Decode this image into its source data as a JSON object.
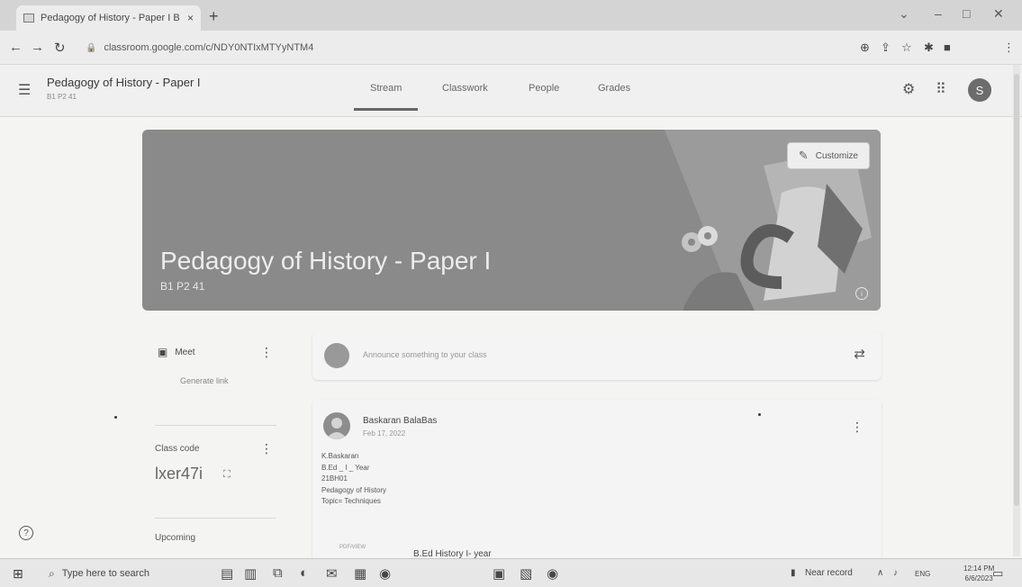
{
  "browser": {
    "tab_title": "Pedagogy of History - Paper I B",
    "tab_close": "×",
    "new_tab": "+",
    "url": "classroom.google.com/c/NDY0NTIxMTYyNTM4",
    "profile_initial": "S"
  },
  "header": {
    "class_name": "Pedagogy of History - Paper I",
    "class_section": "B1 P2 41",
    "tabs": [
      {
        "label": "Stream",
        "active": true
      },
      {
        "label": "Classwork",
        "active": false
      },
      {
        "label": "People",
        "active": false
      },
      {
        "label": "Grades",
        "active": false
      }
    ],
    "avatar_initial": "S"
  },
  "banner": {
    "title": "Pedagogy of History - Paper I",
    "subtitle": "B1 P2 41",
    "customize_label": "Customize"
  },
  "sidebar": {
    "meet_label": "Meet",
    "generate_link": "Generate link",
    "class_code_label": "Class code",
    "class_code": "lxer47i",
    "upcoming_label": "Upcoming"
  },
  "stream": {
    "announce_placeholder": "Announce something to your class",
    "post": {
      "author": "Baskaran BalaBas",
      "date": "Feb 17, 2022",
      "lines": [
        "K.Baskaran",
        "B.Ed _ I _ Year",
        "21BH01",
        "Pedagogy of History",
        "Topic= Techniques"
      ],
      "attachment_thumb": "PDF/VIEW",
      "attachment_title": "B.Ed History I- year"
    }
  },
  "taskbar": {
    "search_placeholder": "Type here to search",
    "weather": "Near record",
    "lang": "ENG",
    "time": "12:14 PM",
    "date": "6/6/2023"
  }
}
